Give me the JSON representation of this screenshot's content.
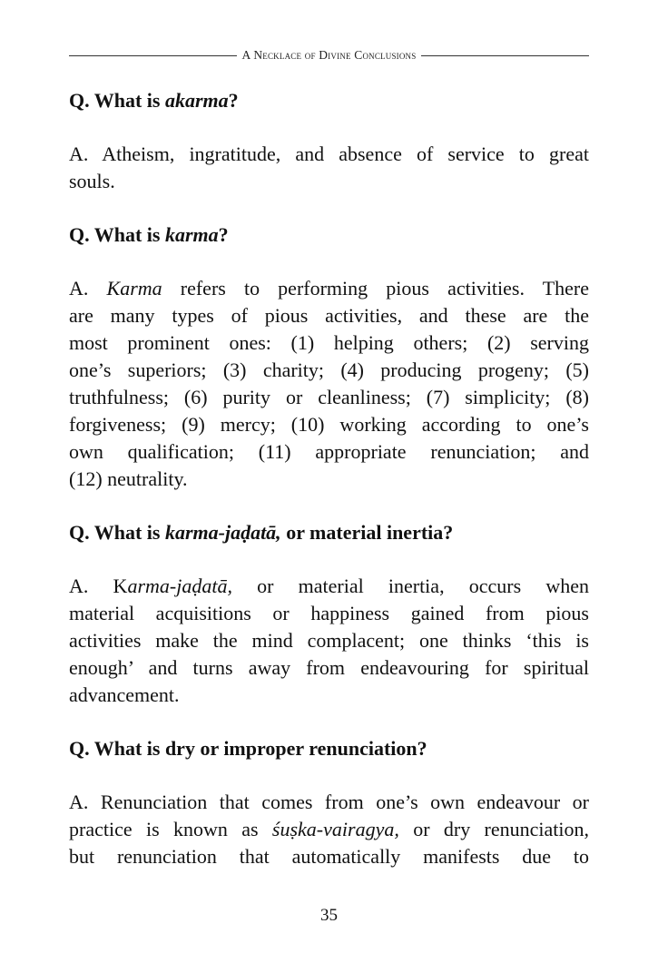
{
  "header": {
    "title": "A Necklace of Divine Conclusions"
  },
  "qa": [
    {
      "q_prefix": "Q. What is ",
      "q_term": "akarma",
      "q_suffix": "?",
      "a_lines": [
        "A. Atheism, ingratitude, and absence of service to great",
        "souls."
      ]
    },
    {
      "q_prefix": "Q. What is ",
      "q_term": "karma",
      "q_suffix": "?",
      "a_first_prefix": "A. ",
      "a_first_term": "Karma",
      "a_first_rest": " refers to performing pious activities. There",
      "a_lines": [
        "are many types of pious activities, and these are the",
        "most prominent ones: (1) helping others; (2) serving",
        "one’s superiors; (3) charity; (4) producing progeny; (5)",
        "truthfulness; (6) purity or cleanliness; (7) simplicity; (8)",
        "forgiveness; (9) mercy; (10) working according to one’s",
        "own qualification; (11) appropriate renunciation; and",
        "(12) neutrality."
      ]
    },
    {
      "q_prefix": "Q. What is ",
      "q_term": "karma-jaḍatā,",
      "q_suffix": " or material inertia?",
      "a_first_prefix": "A. K",
      "a_first_term": "arma-jaḍatā,",
      "a_first_rest": " or material inertia, occurs when",
      "a_lines": [
        "material acquisitions or happiness gained from pious",
        "activities make the mind complacent; one thinks ‘this is",
        "enough’ and turns away from endeavouring for spiritual",
        "advancement."
      ]
    },
    {
      "q_text": "Q. What is dry or improper renunciation?",
      "a_line1": "A. Renunciation that comes from one’s own endeavour or",
      "a_line2_prefix": "practice is known as ",
      "a_line2_term": "śuṣka-vairagya,",
      "a_line2_rest": " or dry renunciation,",
      "a_line3": "but renunciation that automatically manifests due to"
    }
  ],
  "footer": {
    "page_number": "35"
  }
}
